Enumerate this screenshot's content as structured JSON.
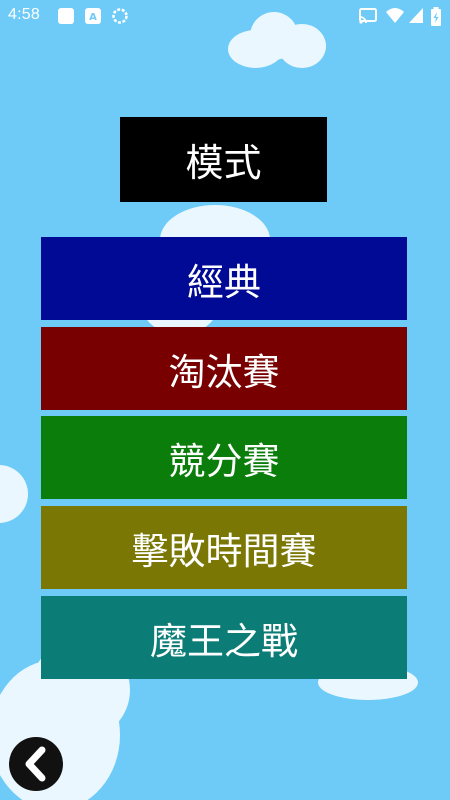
{
  "status_bar": {
    "time": "4:58",
    "icons": [
      "square-app-icon",
      "a-badge-icon",
      "sync-ring-icon",
      "cast-icon",
      "wifi-icon",
      "signal-icon",
      "battery-icon"
    ]
  },
  "screen": {
    "title": "模式",
    "buttons": [
      {
        "label": "經典",
        "color": "#000a94"
      },
      {
        "label": "淘汰賽",
        "color": "#790000"
      },
      {
        "label": "競分賽",
        "color": "#0a7d0a"
      },
      {
        "label": "擊敗時間賽",
        "color": "#7a7704"
      },
      {
        "label": "魔王之戰",
        "color": "#0b7d76"
      }
    ]
  },
  "colors": {
    "sky": "#6ecbf7",
    "cloud": "#eaf7ff",
    "title_box": "#000000",
    "back_button": "#111111"
  },
  "icons": {
    "back": "chevron-left-icon"
  }
}
